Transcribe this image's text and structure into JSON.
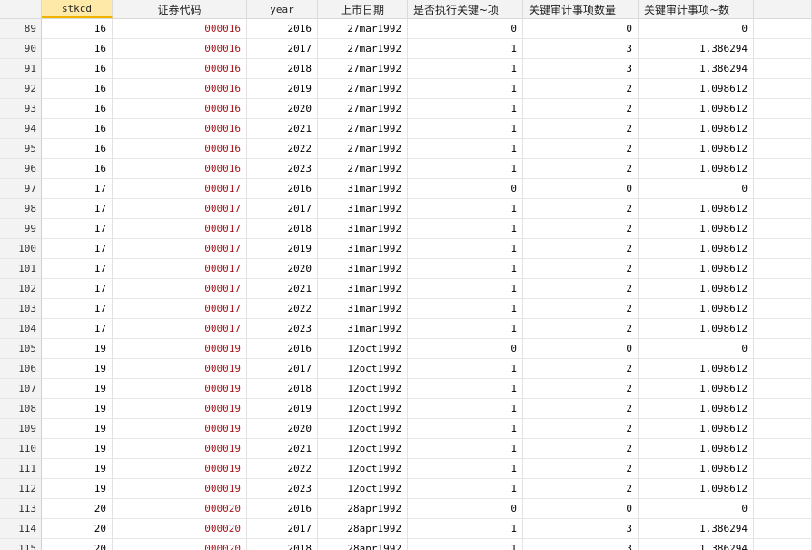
{
  "table": {
    "columns": [
      "",
      "stkcd",
      "证券代码",
      "year",
      "上市日期",
      "是否执行关键~项",
      "关键审计事项数量",
      "关键审计事项~数"
    ],
    "rows": [
      [
        "89",
        "16",
        "000016",
        "2016",
        "27mar1992",
        "0",
        "0",
        "0"
      ],
      [
        "90",
        "16",
        "000016",
        "2017",
        "27mar1992",
        "1",
        "3",
        "1.386294"
      ],
      [
        "91",
        "16",
        "000016",
        "2018",
        "27mar1992",
        "1",
        "3",
        "1.386294"
      ],
      [
        "92",
        "16",
        "000016",
        "2019",
        "27mar1992",
        "1",
        "2",
        "1.098612"
      ],
      [
        "93",
        "16",
        "000016",
        "2020",
        "27mar1992",
        "1",
        "2",
        "1.098612"
      ],
      [
        "94",
        "16",
        "000016",
        "2021",
        "27mar1992",
        "1",
        "2",
        "1.098612"
      ],
      [
        "95",
        "16",
        "000016",
        "2022",
        "27mar1992",
        "1",
        "2",
        "1.098612"
      ],
      [
        "96",
        "16",
        "000016",
        "2023",
        "27mar1992",
        "1",
        "2",
        "1.098612"
      ],
      [
        "97",
        "17",
        "000017",
        "2016",
        "31mar1992",
        "0",
        "0",
        "0"
      ],
      [
        "98",
        "17",
        "000017",
        "2017",
        "31mar1992",
        "1",
        "2",
        "1.098612"
      ],
      [
        "99",
        "17",
        "000017",
        "2018",
        "31mar1992",
        "1",
        "2",
        "1.098612"
      ],
      [
        "100",
        "17",
        "000017",
        "2019",
        "31mar1992",
        "1",
        "2",
        "1.098612"
      ],
      [
        "101",
        "17",
        "000017",
        "2020",
        "31mar1992",
        "1",
        "2",
        "1.098612"
      ],
      [
        "102",
        "17",
        "000017",
        "2021",
        "31mar1992",
        "1",
        "2",
        "1.098612"
      ],
      [
        "103",
        "17",
        "000017",
        "2022",
        "31mar1992",
        "1",
        "2",
        "1.098612"
      ],
      [
        "104",
        "17",
        "000017",
        "2023",
        "31mar1992",
        "1",
        "2",
        "1.098612"
      ],
      [
        "105",
        "19",
        "000019",
        "2016",
        "12oct1992",
        "0",
        "0",
        "0"
      ],
      [
        "106",
        "19",
        "000019",
        "2017",
        "12oct1992",
        "1",
        "2",
        "1.098612"
      ],
      [
        "107",
        "19",
        "000019",
        "2018",
        "12oct1992",
        "1",
        "2",
        "1.098612"
      ],
      [
        "108",
        "19",
        "000019",
        "2019",
        "12oct1992",
        "1",
        "2",
        "1.098612"
      ],
      [
        "109",
        "19",
        "000019",
        "2020",
        "12oct1992",
        "1",
        "2",
        "1.098612"
      ],
      [
        "110",
        "19",
        "000019",
        "2021",
        "12oct1992",
        "1",
        "2",
        "1.098612"
      ],
      [
        "111",
        "19",
        "000019",
        "2022",
        "12oct1992",
        "1",
        "2",
        "1.098612"
      ],
      [
        "112",
        "19",
        "000019",
        "2023",
        "12oct1992",
        "1",
        "2",
        "1.098612"
      ],
      [
        "113",
        "20",
        "000020",
        "2016",
        "28apr1992",
        "0",
        "0",
        "0"
      ],
      [
        "114",
        "20",
        "000020",
        "2017",
        "28apr1992",
        "1",
        "3",
        "1.386294"
      ],
      [
        "115",
        "20",
        "000020",
        "2018",
        "28apr1992",
        "1",
        "3",
        "1.386294"
      ]
    ]
  },
  "colors": {
    "string_value": "#a4161a",
    "selected_header": "#ffe9a8"
  }
}
